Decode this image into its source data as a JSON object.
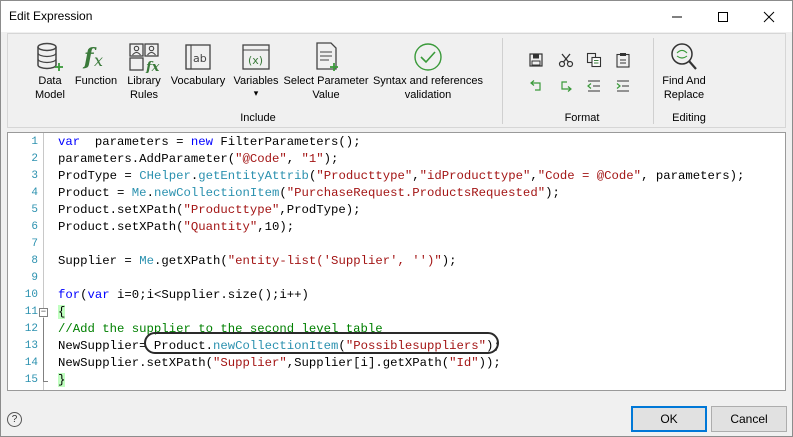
{
  "window": {
    "title": "Edit Expression"
  },
  "ribbon": {
    "items": [
      {
        "label_line1": "Data",
        "label_line2": "Model",
        "icon": "database-icon"
      },
      {
        "label_line1": "Function",
        "label_line2": "",
        "icon": "fx-icon"
      },
      {
        "label_line1": "Library",
        "label_line2": "Rules",
        "icon": "library-rules-icon"
      },
      {
        "label_line1": "Vocabulary",
        "label_line2": "",
        "icon": "vocabulary-icon"
      },
      {
        "label_line1": "Variables",
        "label_line2": "▾",
        "icon": "variables-icon"
      },
      {
        "label_line1": "Select Parameter",
        "label_line2": "Value",
        "icon": "select-parameter-icon"
      },
      {
        "label_line1": "Syntax and references",
        "label_line2": "validation",
        "icon": "checkmark-circle-icon"
      }
    ],
    "include_label": "Include",
    "format_label": "Format",
    "find_replace": {
      "line1": "Find And",
      "line2": "Replace"
    },
    "editing_label": "Editing"
  },
  "editor": {
    "line_numbers": [
      "1",
      "2",
      "3",
      "4",
      "5",
      "6",
      "7",
      "8",
      "9",
      "10",
      "11",
      "12",
      "13",
      "14",
      "15"
    ],
    "lines": [
      [
        [
          "kw",
          "var"
        ],
        [
          "",
          "  parameters = "
        ],
        [
          "kw",
          "new"
        ],
        [
          "",
          " FilterParameters();"
        ]
      ],
      [
        [
          "",
          "parameters.AddParameter("
        ],
        [
          "str",
          "\"@Code\""
        ],
        [
          "",
          ", "
        ],
        [
          "str",
          "\"1\""
        ],
        [
          "",
          ");"
        ]
      ],
      [
        [
          "",
          "ProdType = "
        ],
        [
          "mth",
          "CHelper"
        ],
        [
          "",
          "."
        ],
        [
          "mth",
          "getEntityAttrib"
        ],
        [
          "",
          "("
        ],
        [
          "str",
          "\"Producttype\""
        ],
        [
          "",
          ","
        ],
        [
          "str",
          "\"idProducttype\""
        ],
        [
          "",
          ","
        ],
        [
          "str",
          "\"Code = @Code\""
        ],
        [
          "",
          ", parameters);"
        ]
      ],
      [
        [
          "",
          "Product = "
        ],
        [
          "mth",
          "Me"
        ],
        [
          "",
          "."
        ],
        [
          "mth",
          "newCollectionItem"
        ],
        [
          "",
          "("
        ],
        [
          "str",
          "\"PurchaseRequest.ProductsRequested\""
        ],
        [
          "",
          ");"
        ]
      ],
      [
        [
          "",
          "Product.setXPath("
        ],
        [
          "str",
          "\"Producttype\""
        ],
        [
          "",
          ",ProdType);"
        ]
      ],
      [
        [
          "",
          "Product.setXPath("
        ],
        [
          "str",
          "\"Quantity\""
        ],
        [
          "",
          ",10);"
        ]
      ],
      [],
      [
        [
          "",
          "Supplier = "
        ],
        [
          "mth",
          "Me"
        ],
        [
          "",
          ".getXPath("
        ],
        [
          "str",
          "\"entity-list('Supplier', '')\""
        ],
        [
          "",
          ");"
        ]
      ],
      [],
      [
        [
          "kw",
          "for"
        ],
        [
          "",
          "("
        ],
        [
          "kw",
          "var"
        ],
        [
          "",
          " i=0;i<Supplier.size();i++)"
        ]
      ],
      [
        [
          "brace",
          "{"
        ]
      ],
      [
        [
          "cmt",
          "//Add the supplier to the second level table"
        ]
      ],
      [
        [
          "",
          "NewSupplier= Product."
        ],
        [
          "mth",
          "newCollectionItem"
        ],
        [
          "",
          "("
        ],
        [
          "str",
          "\"Possiblesuppliers\""
        ],
        [
          "",
          ");"
        ]
      ],
      [
        [
          "",
          "NewSupplier.setXPath("
        ],
        [
          "str",
          "\"Supplier\""
        ],
        [
          "",
          ",Supplier[i].getXPath("
        ],
        [
          "str",
          "\"Id\""
        ],
        [
          "",
          "));"
        ]
      ],
      [
        [
          "brace",
          "}"
        ]
      ]
    ]
  },
  "footer": {
    "help": "?",
    "ok": "OK",
    "cancel": "Cancel"
  }
}
